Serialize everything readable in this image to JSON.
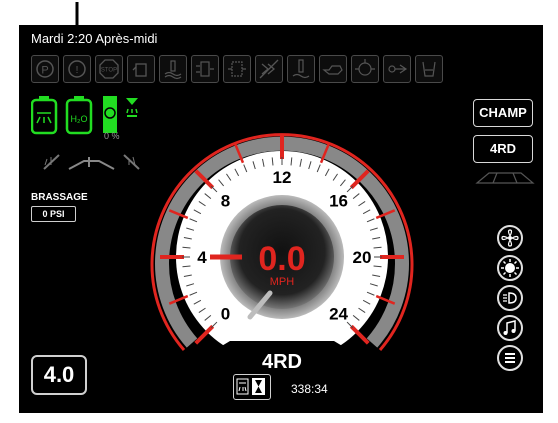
{
  "header": {
    "datetime": "Mardi 2:20 Après-midi"
  },
  "warning_icons": [
    "parking-brake-icon",
    "brake-warning-icon",
    "stop-icon",
    "fuel-water-icon",
    "coolant-level-icon",
    "air-filter-icon",
    "hydraulic-filter-icon",
    "regen-inhibit-icon",
    "hydraulic-temp-icon",
    "engine-oil-icon",
    "engine-warning-icon",
    "transmission-icon",
    "def-level-icon"
  ],
  "status_icons": {
    "percent": "0 %"
  },
  "brassage": {
    "label": "BRASSAGE",
    "value": "0 PSI"
  },
  "speedometer": {
    "value": "0.0",
    "unit": "MPH",
    "ticks": [
      "0",
      "4",
      "8",
      "12",
      "16",
      "20",
      "24"
    ],
    "drive_mode": "4RD"
  },
  "right_panel": {
    "mode_button": "CHAMP",
    "drive_button": "4RD"
  },
  "side_buttons": [
    "fan-icon",
    "light-icon",
    "headlight-icon",
    "music-icon",
    "menu-icon"
  ],
  "bottom": {
    "version": "4.0",
    "hours": "338:34"
  },
  "colors": {
    "accent_red": "#e0251f",
    "status_green": "#22dd22",
    "bezel_gray": "#9b9b9b"
  }
}
